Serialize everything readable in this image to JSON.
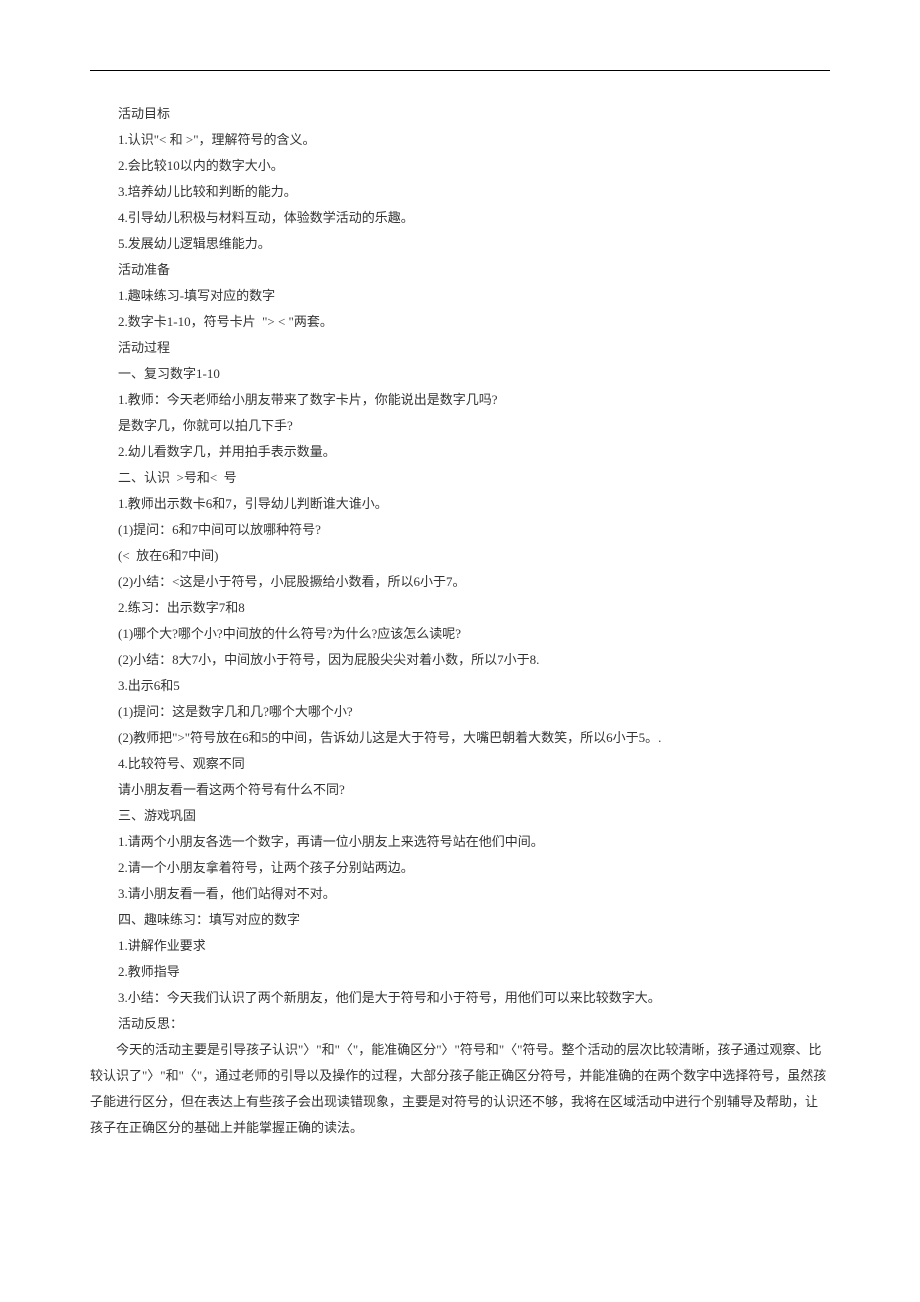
{
  "lines": [
    "活动目标",
    "1.认识\"< 和 >\"，理解符号的含义。",
    "2.会比较10以内的数字大小。",
    "3.培养幼儿比较和判断的能力。",
    "4.引导幼儿积极与材料互动，体验数学活动的乐趣。",
    "5.发展幼儿逻辑思维能力。",
    "活动准备",
    "1.趣味练习-填写对应的数字",
    "2.数字卡1-10，符号卡片  \"> < \"两套。",
    "活动过程",
    "一、复习数字1-10",
    "1.教师：今天老师给小朋友带来了数字卡片，你能说出是数字几吗?",
    "是数字几，你就可以拍几下手?",
    "2.幼儿看数字几，并用拍手表示数量。",
    "二、认识  >号和<  号",
    "1.教师出示数卡6和7，引导幼儿判断谁大谁小。",
    "(1)提问：6和7中间可以放哪种符号?",
    "(<  放在6和7中间)",
    "(2)小结：<这是小于符号，小屁股撅给小数看，所以6小于7。",
    "2.练习：出示数字7和8",
    "(1)哪个大?哪个小?中间放的什么符号?为什么?应该怎么读呢?",
    "(2)小结：8大7小，中间放小于符号，因为屁股尖尖对着小数，所以7小于8.",
    "3.出示6和5",
    "(1)提问：这是数字几和几?哪个大哪个小?",
    "(2)教师把\">\"符号放在6和5的中间，告诉幼儿这是大于符号，大嘴巴朝着大数笑，所以6小于5。.",
    "4.比较符号、观察不同",
    "请小朋友看一看这两个符号有什么不同?",
    "三、游戏巩固",
    "1.请两个小朋友各选一个数字，再请一位小朋友上来选符号站在他们中间。",
    "2.请一个小朋友拿着符号，让两个孩子分别站两边。",
    "3.请小朋友看一看，他们站得对不对。",
    "四、趣味练习：填写对应的数字",
    "1.讲解作业要求",
    "2.教师指导",
    "3.小结：今天我们认识了两个新朋友，他们是大于符号和小于符号，用他们可以来比较数字大。",
    "活动反思："
  ],
  "paragraph": "今天的活动主要是引导孩子认识\"〉\"和\"〈\"，能准确区分\"〉\"符号和\"〈\"符号。整个活动的层次比较清晰，孩子通过观察、比较认识了\"〉\"和\"〈\"，通过老师的引导以及操作的过程，大部分孩子能正确区分符号，并能准确的在两个数字中选择符号，虽然孩子能进行区分，但在表达上有些孩子会出现读错现象，主要是对符号的认识还不够，我将在区域活动中进行个别辅导及帮助，让孩子在正确区分的基础上并能掌握正确的读法。"
}
